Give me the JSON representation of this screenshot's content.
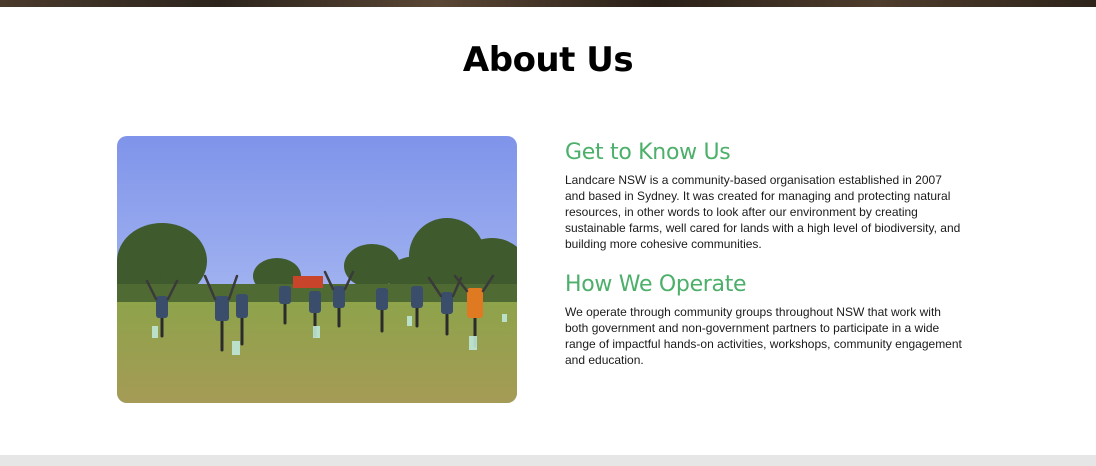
{
  "page": {
    "title": "About Us"
  },
  "photo": {
    "alt": "Group of Landcare volunteers standing in a field with arms raised among newly planted tree guards"
  },
  "sections": [
    {
      "heading": "Get to Know Us",
      "body": "Landcare NSW is a community-based organisation established in 2007 and based in Sydney. It was created for managing and protecting natural resources, in other words to look after our environment by creating sustainable farms, well cared for lands with a high level of biodiversity, and building more cohesive communities."
    },
    {
      "heading": "How We Operate",
      "body": "We operate through community groups throughout NSW that work with both government and non-government partners to participate in a wide range of impactful hands-on activities, workshops, community engagement and education."
    }
  ],
  "colors": {
    "heading_green": "#4caf6a",
    "footer_gray": "#e6e6e6"
  }
}
